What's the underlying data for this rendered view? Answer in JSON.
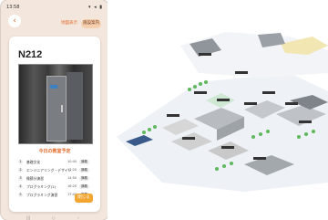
{
  "status_bar": {
    "time": "13:58",
    "indicators": "▾ ◂ ▮"
  },
  "header": {
    "back_icon": "chevron-left-icon",
    "back_label": "‹",
    "tabs": [
      {
        "label": "地図表示"
      },
      {
        "label": "施設案内"
      }
    ],
    "colors": {
      "accent": "#e36c2d",
      "tab_active_bg": "#f6cfae",
      "background": "#f3e6dc"
    }
  },
  "room_card": {
    "room_name": "N212",
    "schedule_title": "今日の教室予定",
    "schedule": [
      {
        "period": "1",
        "subject": "基礎文化",
        "time": "10:40",
        "tag": "講義"
      },
      {
        "period": "2",
        "subject": "エンジニアリング・デザイン",
        "time": "12:20",
        "tag": "講義"
      },
      {
        "period": "3",
        "subject": "微積分演習",
        "time": "14:50",
        "tag": "講義"
      },
      {
        "period": "4",
        "subject": "プログラミング(1)",
        "time": "16:20",
        "tag": "講義"
      },
      {
        "period": "5",
        "subject": "プログラミング演習",
        "time": "17:40",
        "tag": "講義"
      }
    ],
    "close_label": "閉じる",
    "close_color": "#f3a532"
  },
  "nav_bar": {
    "items": [
      "|||",
      "○",
      "‹"
    ]
  },
  "map": {
    "description_icon": "campus-map",
    "ground_color": "#e8edf3",
    "building_color": "#c9c9c9"
  }
}
